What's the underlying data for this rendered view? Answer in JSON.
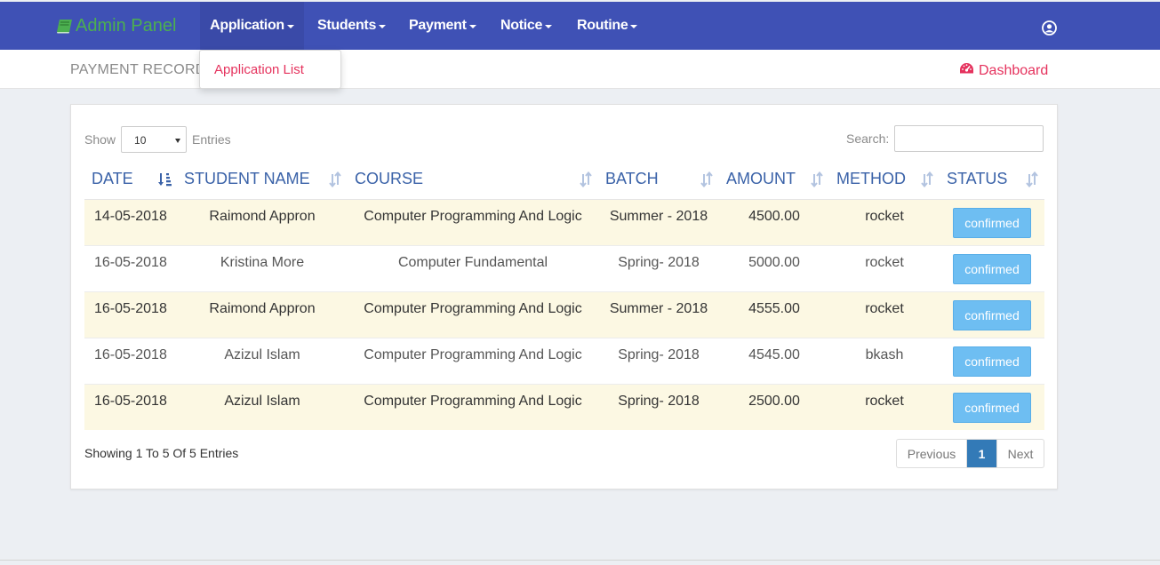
{
  "navbar": {
    "brand": "Admin Panel",
    "menu": [
      {
        "label": "Application"
      },
      {
        "label": "Students"
      },
      {
        "label": "Payment"
      },
      {
        "label": "Notice"
      },
      {
        "label": "Routine"
      }
    ],
    "dropdown": {
      "item": "Application List"
    },
    "user_icon": "user-circle-icon"
  },
  "subheader": {
    "title": "PAYMENT RECORD",
    "dashboard_link": "Dashboard"
  },
  "table_controls": {
    "show_label": "Show",
    "page_length": "10",
    "entries_label": "Entries",
    "search_label": "Search:"
  },
  "table": {
    "headers": [
      "DATE",
      "STUDENT NAME",
      "COURSE",
      "BATCH",
      "AMOUNT",
      "METHOD",
      "STATUS"
    ],
    "rows": [
      {
        "date": "14-05-2018",
        "name": "Raimond Appron",
        "course": "Computer Programming And Logic",
        "batch": "Summer - 2018",
        "amount": "4500.00",
        "method": "rocket",
        "status": "confirmed"
      },
      {
        "date": "16-05-2018",
        "name": "Kristina More",
        "course": "Computer Fundamental",
        "batch": "Spring- 2018",
        "amount": "5000.00",
        "method": "rocket",
        "status": "confirmed"
      },
      {
        "date": "16-05-2018",
        "name": "Raimond Appron",
        "course": "Computer Programming And Logic",
        "batch": "Summer - 2018",
        "amount": "4555.00",
        "method": "rocket",
        "status": "confirmed"
      },
      {
        "date": "16-05-2018",
        "name": "Azizul Islam",
        "course": "Computer Programming And Logic",
        "batch": "Spring- 2018",
        "amount": "4545.00",
        "method": "bkash",
        "status": "confirmed"
      },
      {
        "date": "16-05-2018",
        "name": "Azizul Islam",
        "course": "Computer Programming And Logic",
        "batch": "Spring- 2018",
        "amount": "2500.00",
        "method": "rocket",
        "status": "confirmed"
      }
    ]
  },
  "footer": {
    "info": "Showing 1 To 5 Of 5 Entries",
    "pagination": {
      "previous": "Previous",
      "current": "1",
      "next": "Next"
    }
  },
  "colors": {
    "navbar": "#3f51b5",
    "brand": "#4caf50",
    "accent_link": "#e5325d",
    "header_text": "#3a62a8",
    "status_button": "#6ebef2",
    "odd_row": "#fcf8e3",
    "page_active": "#337ab7"
  }
}
